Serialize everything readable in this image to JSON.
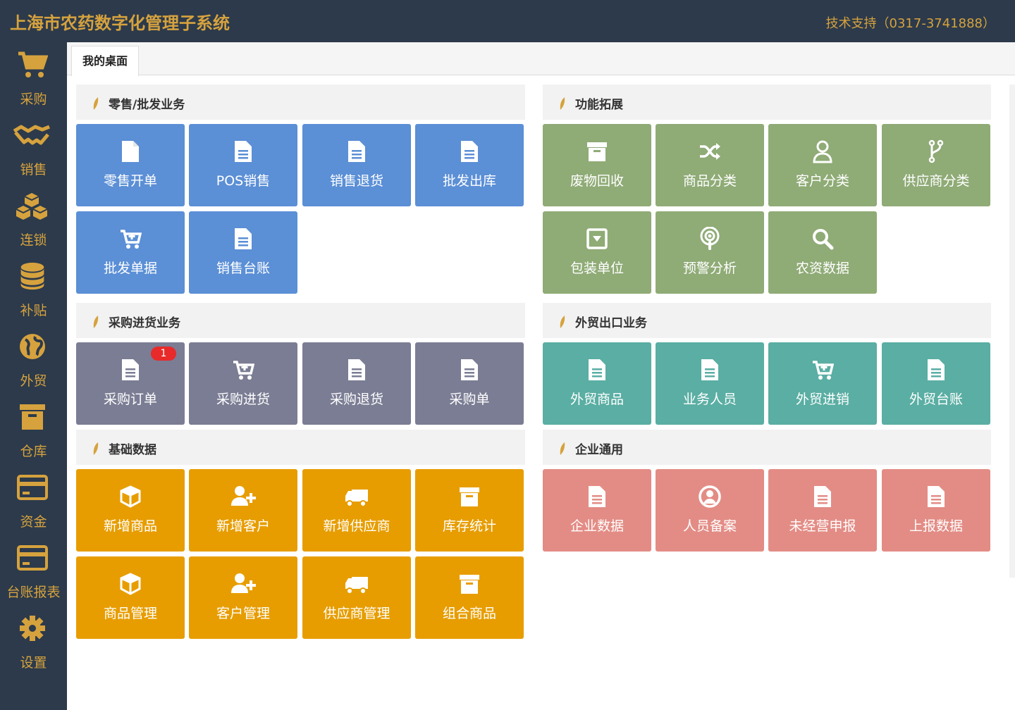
{
  "app": {
    "title": "上海市农药数字化管理子系统",
    "support": "技术支持（0317-3741888）"
  },
  "sidebar": {
    "items": [
      {
        "label": "采购",
        "icon": "cart-icon"
      },
      {
        "label": "销售",
        "icon": "handshake-icon"
      },
      {
        "label": "连锁",
        "icon": "cubes-icon"
      },
      {
        "label": "补贴",
        "icon": "database-icon"
      },
      {
        "label": "外贸",
        "icon": "globe-icon"
      },
      {
        "label": "仓库",
        "icon": "archive-icon"
      },
      {
        "label": "资金",
        "icon": "credit-card-icon"
      },
      {
        "label": "台账报表",
        "icon": "credit-card-icon"
      },
      {
        "label": "设置",
        "icon": "gear-icon"
      }
    ]
  },
  "tabs": [
    {
      "label": "我的桌面"
    }
  ],
  "sections": {
    "retail": {
      "title": "零售/批发业务",
      "tiles": [
        {
          "label": "零售开单",
          "icon": "document-icon"
        },
        {
          "label": "POS销售",
          "icon": "document-icon"
        },
        {
          "label": "销售退货",
          "icon": "document-icon"
        },
        {
          "label": "批发出库",
          "icon": "document-icon"
        },
        {
          "label": "批发单据",
          "icon": "cart-plus-icon"
        },
        {
          "label": "销售台账",
          "icon": "document-icon"
        }
      ]
    },
    "extend": {
      "title": "功能拓展",
      "tiles": [
        {
          "label": "废物回收",
          "icon": "archive-icon"
        },
        {
          "label": "商品分类",
          "icon": "shuffle-icon"
        },
        {
          "label": "客户分类",
          "icon": "user-icon"
        },
        {
          "label": "供应商分类",
          "icon": "fork-icon"
        },
        {
          "label": "包装单位",
          "icon": "box-down-icon"
        },
        {
          "label": "预警分析",
          "icon": "podcast-icon"
        },
        {
          "label": "农资数据",
          "icon": "search-icon"
        }
      ]
    },
    "purchase": {
      "title": "采购进货业务",
      "badge": "1",
      "tiles": [
        {
          "label": "采购订单",
          "icon": "document-icon"
        },
        {
          "label": "采购进货",
          "icon": "cart-plus-icon"
        },
        {
          "label": "采购退货",
          "icon": "document-icon"
        },
        {
          "label": "采购单",
          "icon": "document-icon"
        }
      ]
    },
    "trade": {
      "title": "外贸出口业务",
      "tiles": [
        {
          "label": "外贸商品",
          "icon": "document-icon"
        },
        {
          "label": "业务人员",
          "icon": "document-icon"
        },
        {
          "label": "外贸进销",
          "icon": "cart-plus-icon"
        },
        {
          "label": "外贸台账",
          "icon": "document-icon"
        }
      ]
    },
    "basic": {
      "title": "基础数据",
      "tiles": [
        {
          "label": "新增商品",
          "icon": "cube-icon"
        },
        {
          "label": "新增客户",
          "icon": "user-plus-icon"
        },
        {
          "label": "新增供应商",
          "icon": "truck-icon"
        },
        {
          "label": "库存统计",
          "icon": "archive-icon"
        },
        {
          "label": "商品管理",
          "icon": "cube-icon"
        },
        {
          "label": "客户管理",
          "icon": "user-plus-icon"
        },
        {
          "label": "供应商管理",
          "icon": "truck-icon"
        },
        {
          "label": "组合商品",
          "icon": "archive-icon"
        }
      ]
    },
    "enterprise": {
      "title": "企业通用",
      "tiles": [
        {
          "label": "企业数据",
          "icon": "document-icon"
        },
        {
          "label": "人员备案",
          "icon": "user-circle-icon"
        },
        {
          "label": "未经营申报",
          "icon": "document-icon"
        },
        {
          "label": "上报数据",
          "icon": "document-icon"
        }
      ]
    }
  },
  "colors": {
    "header": "#2c3a4b",
    "accent": "#d6a23e",
    "blue": "#5b8fd6",
    "green": "#8fab76",
    "gray": "#7b7d94",
    "teal": "#5aaea3",
    "orange": "#e79d00",
    "pink": "#e38c85"
  }
}
